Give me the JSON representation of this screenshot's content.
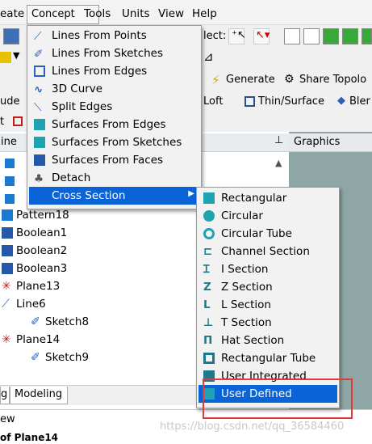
{
  "menubar": {
    "items": [
      "eate",
      "Concept",
      "Tools",
      "Units",
      "View",
      "Help"
    ]
  },
  "toolbar": {
    "select_label": "lect:",
    "generate_label": "Generate",
    "share_topology_label": "Share Topolo",
    "loft_label": "Loft",
    "thin_surface_label": "Thin/Surface",
    "blend_label": "Bler",
    "left_fragment_1": "ude",
    "left_fragment_2": "t"
  },
  "concept_menu": [
    "Lines From Points",
    "Lines From Sketches",
    "Lines From Edges",
    "3D Curve",
    "Split Edges",
    "Surfaces From Edges",
    "Surfaces From Sketches",
    "Surfaces From Faces",
    "Detach",
    "Cross Section"
  ],
  "cross_section_menu": [
    "Rectangular",
    "Circular",
    "Circular Tube",
    "Channel Section",
    "I Section",
    "Z Section",
    "L Section",
    "T Section",
    "Hat Section",
    "Rectangular Tube",
    "User Integrated",
    "User Defined"
  ],
  "tree": {
    "header": "ine",
    "pin": "ᵖ",
    "items": [
      "Pattern18",
      "Boolean1",
      "Boolean2",
      "Boolean3",
      "Plane13",
      "Line6",
      "Sketch8",
      "Plane14",
      "Sketch9"
    ]
  },
  "graphics": {
    "header": "Graphics"
  },
  "bottom_tabs": [
    "g",
    "Modeling"
  ],
  "details": {
    "header": "ew",
    "title": "of Plane14"
  },
  "watermark": "https://blog.csdn.net/qq_36584460",
  "colors": {
    "highlight": "#0a64d8",
    "annotation": "#e23a3a"
  }
}
